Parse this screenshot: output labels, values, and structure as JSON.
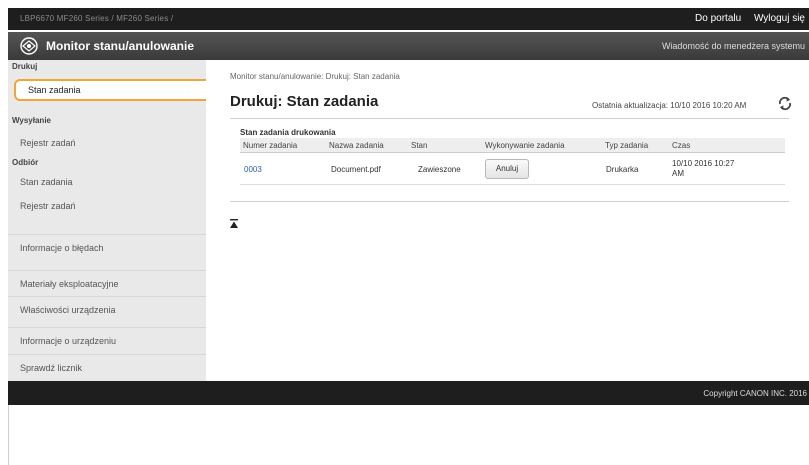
{
  "topbar": {
    "crumbs": "LBP6670   MF260 Series / MF260 Series /",
    "portal_link": "Do portalu",
    "logout_link": "Wyloguj się"
  },
  "titlebar": {
    "title": "Monitor stanu/anulowanie",
    "message_link": "Wiadomość do menedżera systemu"
  },
  "sidebar": {
    "sections": [
      {
        "label": "Drukuj",
        "items": [
          "Stan zadania"
        ]
      },
      {
        "label": "Wysyłanie",
        "items": [
          "Rejestr zadań"
        ]
      },
      {
        "label": "Odbiór",
        "items": [
          "Stan zadania",
          "Rejestr zadań"
        ]
      }
    ],
    "extra_items": [
      "Informacje o błędach",
      "Materiały eksploatacyjne",
      "Właściwości urządzenia",
      "Informacje o urządzeniu",
      "Sprawdź licznik"
    ]
  },
  "main": {
    "breadcrumb": "Monitor stanu/anulowanie: Drukuj: Stan zadania",
    "title": "Drukuj: Stan zadania",
    "last_update": "Ostatnia aktualizacja: 10/10 2016 10:20 AM",
    "table": {
      "caption": "Stan zadania drukowania",
      "headers": [
        "Numer zadania",
        "Nazwa zadania",
        "Stan",
        "Wykonywanie zadania",
        "Typ zadania",
        "Czas"
      ],
      "rows": [
        {
          "job_number": "0003",
          "job_name": "Document.pdf",
          "status": "Zawieszone",
          "action": "Anuluj",
          "job_type": "Drukarka",
          "time": "10/10 2016 10:27 AM"
        }
      ]
    }
  },
  "footer": {
    "copyright": "Copyright CANON INC. 2016"
  }
}
